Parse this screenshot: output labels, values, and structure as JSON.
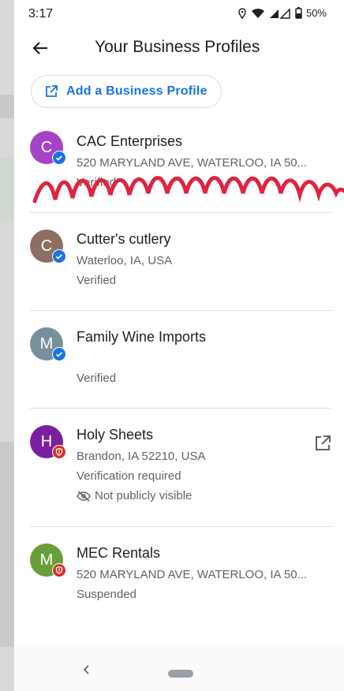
{
  "status_bar": {
    "time": "3:17",
    "battery": "50%"
  },
  "header": {
    "title": "Your Business Profiles"
  },
  "add_button": {
    "label": "Add a Business Profile"
  },
  "colors": {
    "accent": "#1a73e8",
    "verified": "#1a73e8",
    "warning": "#d93025"
  },
  "profiles": [
    {
      "initial": "C",
      "name": "CAC Enterprises",
      "address": "520 MARYLAND AVE, WATERLOO, IA 50...",
      "status": "Verified",
      "avatar_color": "#a742c6",
      "badge": "verified-check-icon"
    },
    {
      "initial": "C",
      "name": "Cutter's cutlery",
      "address": "Waterloo, IA, USA",
      "status": "Verified",
      "avatar_color": "#8d6e63",
      "badge": "verified-check-icon"
    },
    {
      "initial": "M",
      "name": "Family Wine Imports",
      "address": "",
      "status": "Verified",
      "avatar_color": "#78909c",
      "badge": "verified-check-icon"
    },
    {
      "initial": "H",
      "name": "Holy Sheets",
      "address": "Brandon, IA 52210, USA",
      "status": "Verification required",
      "visibility": "Not publicly visible",
      "avatar_color": "#7b1fa2",
      "badge": "warning-shield-icon"
    },
    {
      "initial": "M",
      "name": "MEC Rentals",
      "address": "520 MARYLAND AVE, WATERLOO, IA 50...",
      "status": "Suspended",
      "avatar_color": "#689f38",
      "badge": "warning-shield-icon"
    }
  ]
}
